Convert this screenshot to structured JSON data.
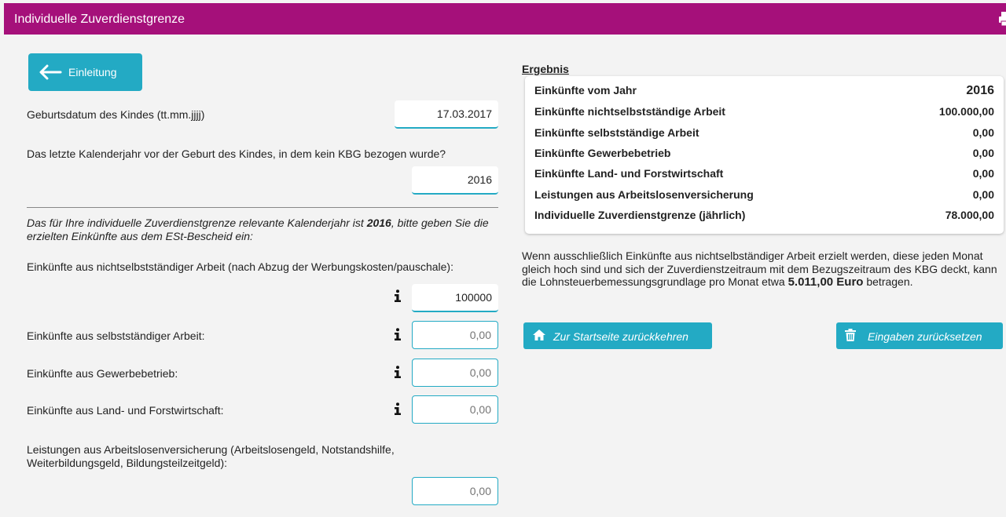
{
  "header": {
    "title": "Individuelle Zuverdienstgrenze",
    "print_icon": "print-icon"
  },
  "form": {
    "intro_button_label": "Einleitung",
    "birthdate": {
      "label": "Geburtsdatum des Kindes (tt.mm.jjjj)",
      "value": "17.03.2017"
    },
    "year_question": {
      "label": "Das letzte Kalenderjahr vor der Geburt des Kindes, in dem kein KBG bezogen wurde?",
      "value": "2016"
    },
    "note": {
      "part1": "Das für Ihre individuelle Zuverdienstgrenze relevante Kalenderjahr ist ",
      "year": "2016",
      "part2": ", bitte geben Sie die erzielten Einkünfte aus dem ESt-Bescheid ein:"
    },
    "income_nonself": {
      "label": "Einkünfte aus nichtselbstständiger Arbeit (nach Abzug der Werbungskosten/pauschale):",
      "value": "100000"
    },
    "income_self": {
      "label": "Einkünfte aus selbstständiger Arbeit:",
      "placeholder": "0,00"
    },
    "income_business": {
      "label": "Einkünfte aus Gewerbebetrieb:",
      "placeholder": "0,00"
    },
    "income_agri": {
      "label": "Einkünfte aus Land- und Forstwirtschaft:",
      "placeholder": "0,00"
    },
    "unemployment": {
      "label_line1": "Leistungen aus Arbeitslosenversicherung (Arbeitslosengeld, Notstandshilfe,",
      "label_line2": "Weiterbildungsgeld, Bildungsteilzeitgeld):",
      "placeholder": "0,00"
    }
  },
  "ergebnis": {
    "title": "Ergebnis",
    "rows": [
      {
        "key": "Einkünfte vom Jahr",
        "value": "2016"
      },
      {
        "key": "Einkünfte nichtselbstständige Arbeit",
        "value": "100.000,00"
      },
      {
        "key": "Einkünfte selbstständige Arbeit",
        "value": "0,00"
      },
      {
        "key": "Einkünfte Gewerbebetrieb",
        "value": "0,00"
      },
      {
        "key": "Einkünfte Land- und Forstwirtschaft",
        "value": "0,00"
      },
      {
        "key": "Leistungen aus Arbeitslosenversicherung",
        "value": "0,00"
      },
      {
        "key": "Individuelle Zuverdienstgrenze (jährlich)",
        "value": "78.000,00"
      }
    ],
    "info_text": "Wenn ausschließlich Einkünfte aus nichtselbständiger Arbeit erzielt werden, diese jeden Monat gleich hoch sind und sich der Zuverdienstzeitraum mit dem Bezugszeitraum des KBG deckt, kann die Lohnsteuerbemessungsgrundlage pro Monat etwa ",
    "info_amount": "5.011,00 Euro",
    "info_suffix": " betragen."
  },
  "buttons": {
    "home_label": "Zur Startseite zurückkehren",
    "reset_label": "Eingaben zurücksetzen"
  },
  "colors": {
    "brand": "#a5107a",
    "accent": "#23aac4"
  }
}
